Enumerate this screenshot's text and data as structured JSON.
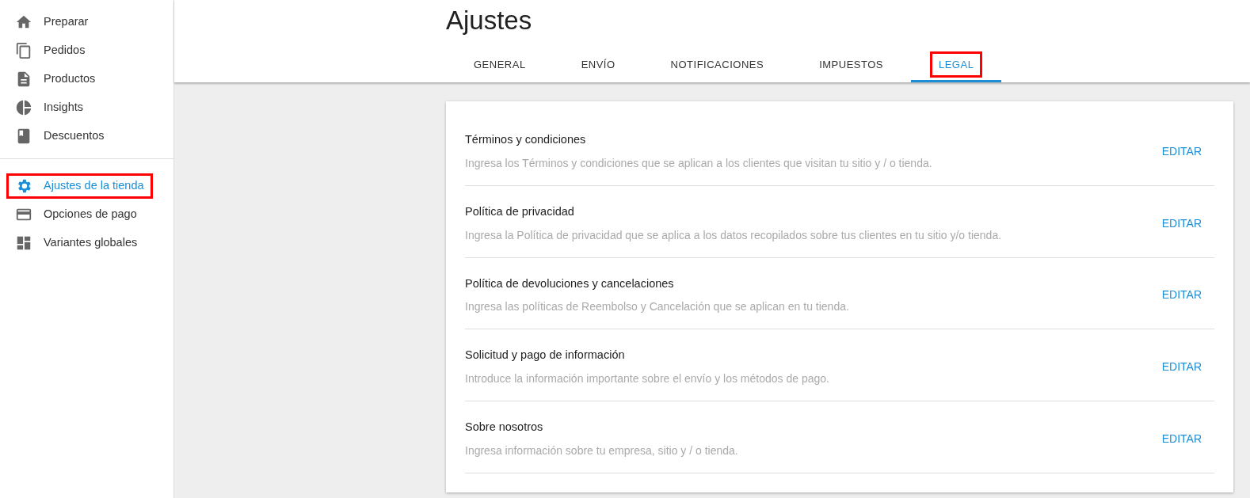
{
  "sidebar": {
    "groups": [
      {
        "items": [
          {
            "label": "Preparar",
            "selected": false,
            "annotated": false
          },
          {
            "label": "Pedidos",
            "selected": false,
            "annotated": false
          },
          {
            "label": "Productos",
            "selected": false,
            "annotated": false
          },
          {
            "label": "Insights",
            "selected": false,
            "annotated": false
          },
          {
            "label": "Descuentos",
            "selected": false,
            "annotated": false
          }
        ]
      },
      {
        "items": [
          {
            "label": "Ajustes de la tienda",
            "selected": true,
            "annotated": true
          },
          {
            "label": "Opciones de pago",
            "selected": false,
            "annotated": false
          },
          {
            "label": "Variantes globales",
            "selected": false,
            "annotated": false
          }
        ]
      }
    ]
  },
  "page_title": "Ajustes",
  "tabs": [
    {
      "label": "GENERAL",
      "selected": false,
      "annotated": false
    },
    {
      "label": "ENVÍO",
      "selected": false,
      "annotated": false
    },
    {
      "label": "NOTIFICACIONES",
      "selected": false,
      "annotated": false
    },
    {
      "label": "IMPUESTOS",
      "selected": false,
      "annotated": false
    },
    {
      "label": "LEGAL",
      "selected": true,
      "annotated": true
    }
  ],
  "legal_sections": [
    {
      "title": "Términos y condiciones",
      "description": "Ingresa los Términos y condiciones que se aplican a los clientes que visitan tu sitio y / o tienda.",
      "action": "EDITAR"
    },
    {
      "title": "Política de privacidad",
      "description": "Ingresa la Política de privacidad que se aplica a los datos recopilados sobre tus clientes en tu sitio y/o tienda.",
      "action": "EDITAR"
    },
    {
      "title": "Política de devoluciones y cancelaciones",
      "description": "Ingresa las políticas de Reembolso y Cancelación que se aplican en tu tienda.",
      "action": "EDITAR"
    },
    {
      "title": "Solicitud y pago de información",
      "description": "Introduce la información importante sobre el envío y los métodos de pago.",
      "action": "EDITAR"
    },
    {
      "title": "Sobre nosotros",
      "description": "Ingresa información sobre tu empresa, sitio y / o tienda.",
      "action": "EDITAR"
    }
  ]
}
